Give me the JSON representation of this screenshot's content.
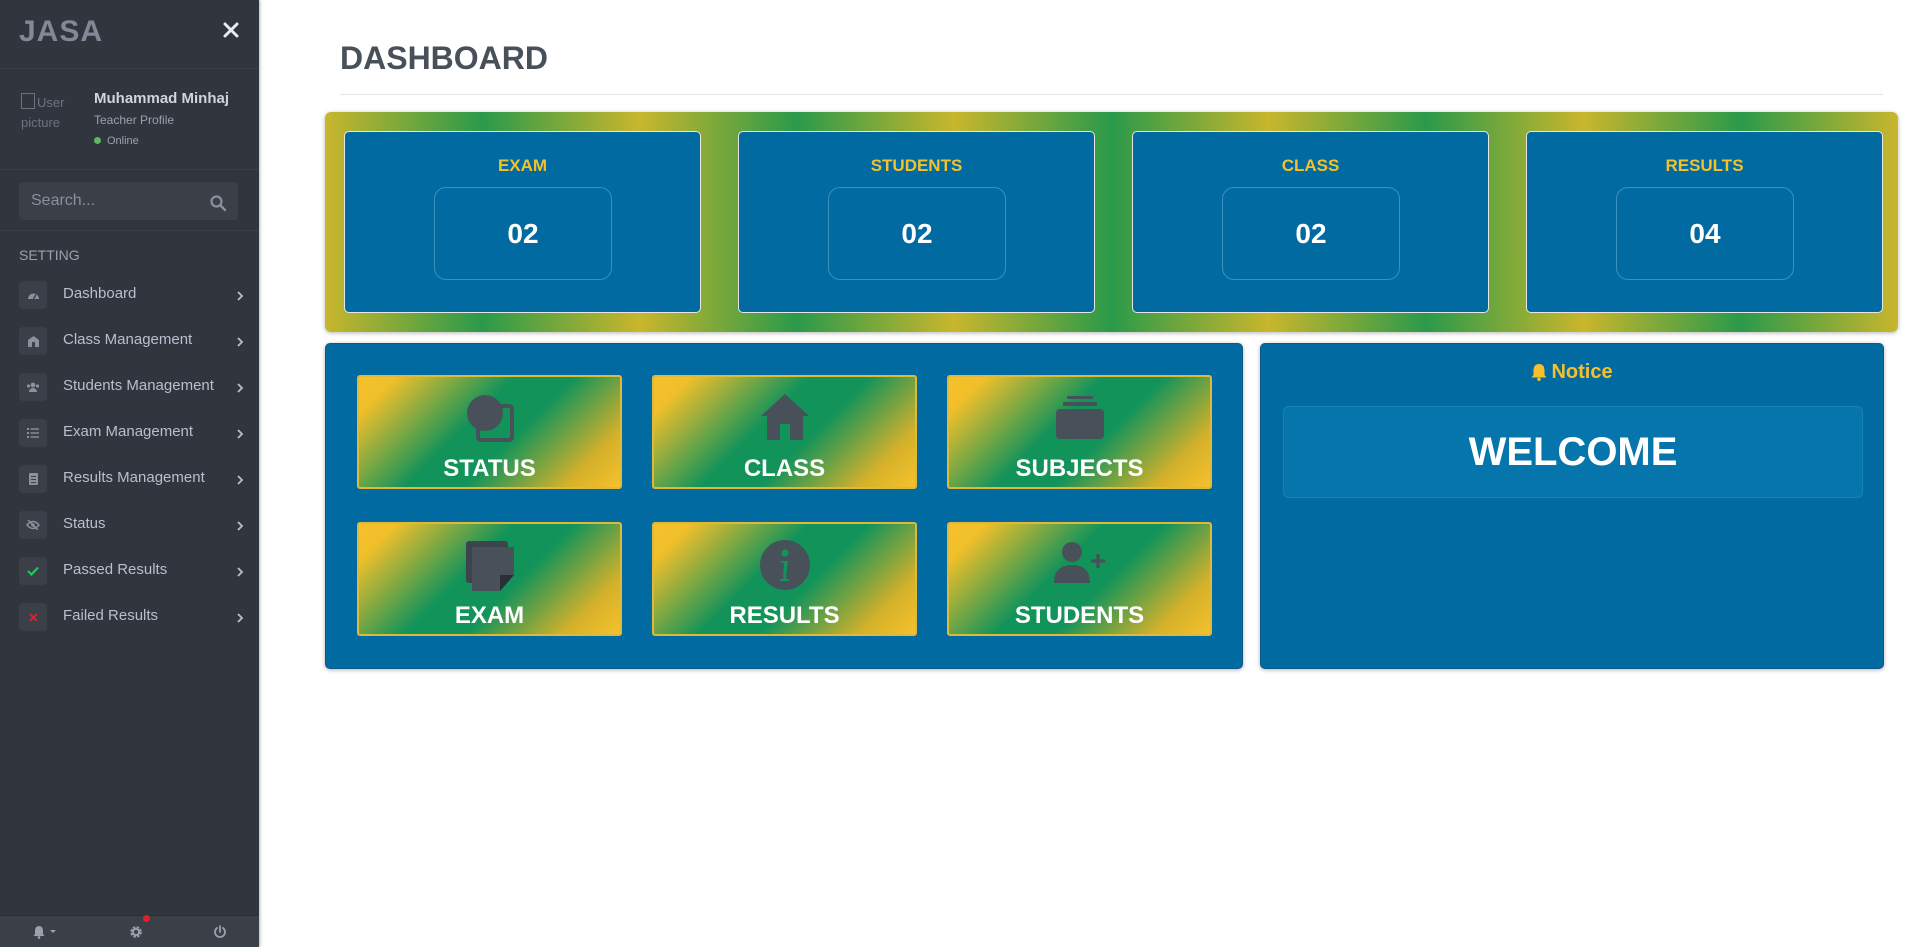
{
  "app": {
    "brand": "JASA"
  },
  "user": {
    "name": "Muhammad Minhaj",
    "role": "Teacher Profile",
    "status": "Online",
    "avatar_alt": "User picture"
  },
  "search": {
    "placeholder": "Search..."
  },
  "sidebar": {
    "section_title": "SETTING",
    "items": [
      {
        "label": "Dashboard",
        "icon": "dashboard-icon"
      },
      {
        "label": "Class Management",
        "icon": "school-icon"
      },
      {
        "label": "Students Management",
        "icon": "users-icon"
      },
      {
        "label": "Exam Management",
        "icon": "list-icon"
      },
      {
        "label": "Results Management",
        "icon": "document-icon"
      },
      {
        "label": "Status",
        "icon": "eye-slash-icon"
      },
      {
        "label": "Passed Results",
        "icon": "check-icon"
      },
      {
        "label": "Failed Results",
        "icon": "times-icon"
      }
    ]
  },
  "footer": {
    "icons": [
      "bell-icon",
      "gear-icon",
      "power-icon"
    ]
  },
  "page": {
    "title": "DASHBOARD"
  },
  "stats": [
    {
      "label": "EXAM",
      "value": "02"
    },
    {
      "label": "STUDENTS",
      "value": "02"
    },
    {
      "label": "CLASS",
      "value": "02"
    },
    {
      "label": "RESULTS",
      "value": "04"
    }
  ],
  "tiles": [
    {
      "label": "STATUS",
      "icon": "status-icon"
    },
    {
      "label": "CLASS",
      "icon": "home-icon"
    },
    {
      "label": "SUBJECTS",
      "icon": "briefcase-icon"
    },
    {
      "label": "EXAM",
      "icon": "sticky-note-icon"
    },
    {
      "label": "RESULTS",
      "icon": "info-icon"
    },
    {
      "label": "STUDENTS",
      "icon": "add-user-icon"
    }
  ],
  "notice": {
    "title": "Notice",
    "message": "WELCOME"
  },
  "colors": {
    "sidebar_bg": "#31353d",
    "panel_blue": "#016ba1",
    "accent_yellow": "#f4c02c",
    "accent_green": "#12935a"
  }
}
